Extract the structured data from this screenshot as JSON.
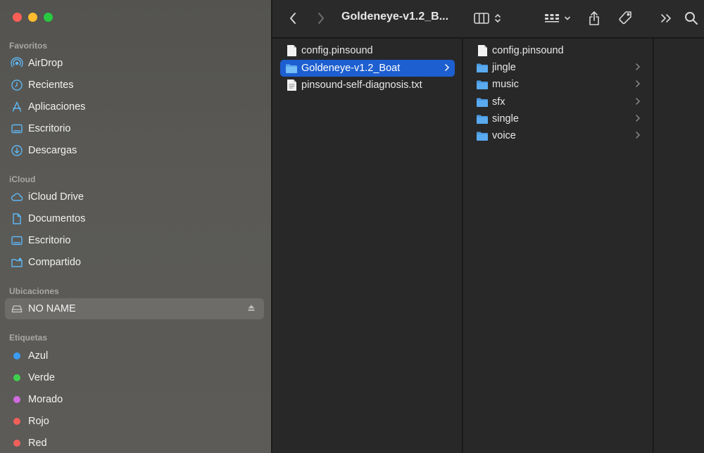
{
  "window": {
    "title": "Goldeneye-v1.2_B..."
  },
  "sidebar": {
    "sections": [
      {
        "title": "Favoritos",
        "items": [
          {
            "label": "AirDrop",
            "icon": "airdrop-icon"
          },
          {
            "label": "Recientes",
            "icon": "clock-icon"
          },
          {
            "label": "Aplicaciones",
            "icon": "applications-icon"
          },
          {
            "label": "Escritorio",
            "icon": "desktop-icon"
          },
          {
            "label": "Descargas",
            "icon": "download-icon"
          }
        ]
      },
      {
        "title": "iCloud",
        "items": [
          {
            "label": "iCloud Drive",
            "icon": "cloud-icon"
          },
          {
            "label": "Documentos",
            "icon": "document-icon"
          },
          {
            "label": "Escritorio",
            "icon": "desktop-icon"
          },
          {
            "label": "Compartido",
            "icon": "shared-folder-icon"
          }
        ]
      },
      {
        "title": "Ubicaciones",
        "items": [
          {
            "label": "NO NAME",
            "icon": "drive-icon",
            "selected": true,
            "eject": true
          }
        ]
      },
      {
        "title": "Etiquetas",
        "items": [
          {
            "label": "Azul",
            "color": "#3a9cf5"
          },
          {
            "label": "Verde",
            "color": "#3fd14e"
          },
          {
            "label": "Morado",
            "color": "#d06be0"
          },
          {
            "label": "Rojo",
            "color": "#f0605a"
          },
          {
            "label": "Red",
            "color": "#f0605a"
          }
        ]
      }
    ]
  },
  "columns": [
    {
      "items": [
        {
          "name": "config.pinsound",
          "kind": "file"
        },
        {
          "name": "Goldeneye-v1.2_Boat",
          "kind": "folder",
          "selected": true
        },
        {
          "name": "pinsound-self-diagnosis.txt",
          "kind": "text-file"
        }
      ]
    },
    {
      "items": [
        {
          "name": "config.pinsound",
          "kind": "file"
        },
        {
          "name": "jingle",
          "kind": "folder"
        },
        {
          "name": "music",
          "kind": "folder"
        },
        {
          "name": "sfx",
          "kind": "folder"
        },
        {
          "name": "single",
          "kind": "folder"
        },
        {
          "name": "voice",
          "kind": "folder"
        }
      ]
    }
  ],
  "colors": {
    "accent": "#1d5fd0",
    "sidebarIcon": "#5fb6f2",
    "folder": "#5aaaf0"
  }
}
